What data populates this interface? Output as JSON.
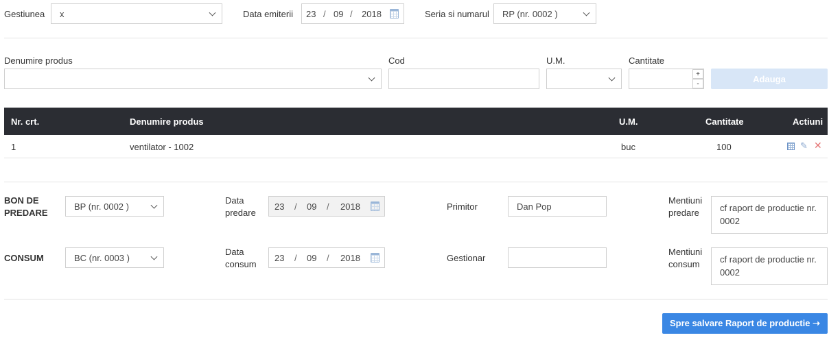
{
  "header": {
    "gestiunea_label": "Gestiunea",
    "gestiunea_value": "x",
    "data_emiterii_label": "Data emiterii",
    "data_emiterii": {
      "day": "23",
      "month": "09",
      "year": "2018"
    },
    "seria_label": "Seria si numarul",
    "seria_value": "RP (nr. 0002 )"
  },
  "form": {
    "denumire_label": "Denumire produs",
    "denumire_value": "",
    "cod_label": "Cod",
    "cod_value": "",
    "um_label": "U.M.",
    "um_value": "",
    "cantitate_label": "Cantitate",
    "cantitate_value": "",
    "plus": "+",
    "minus": "-",
    "add_label": "Adauga"
  },
  "table": {
    "headers": [
      "Nr. crt.",
      "Denumire produs",
      "U.M.",
      "Cantitate",
      "Actiuni"
    ],
    "rows": [
      {
        "nr": "1",
        "denumire": "ventilator - 1002",
        "um": "buc",
        "cantitate": "100"
      }
    ]
  },
  "bon": {
    "label_line1": "BON DE",
    "label_line2": "PREDARE",
    "value": "BP (nr. 0002 )",
    "data_label_line1": "Data",
    "data_label_line2": "predare",
    "date": {
      "day": "23",
      "month": "09",
      "year": "2018"
    },
    "primitor_label": "Primitor",
    "primitor_value": "Dan Pop",
    "mentiuni_label_line1": "Mentiuni",
    "mentiuni_label_line2": "predare",
    "mentiuni_line1": "cf raport de productie nr.",
    "mentiuni_line2": "0002"
  },
  "consum": {
    "label": "CONSUM",
    "value": "BC (nr. 0003 )",
    "data_label_line1": "Data",
    "data_label_line2": "consum",
    "date": {
      "day": "23",
      "month": "09",
      "year": "2018"
    },
    "gestionar_label": "Gestionar",
    "gestionar_value": "",
    "mentiuni_label_line1": "Mentiuni",
    "mentiuni_label_line2": "consum",
    "mentiuni_line1": "cf raport de productie nr.",
    "mentiuni_line2": "0002"
  },
  "footer": {
    "save_label": "Spre salvare Raport de productie ➝"
  },
  "date_sep": "/",
  "colors": {
    "primary": "#3a87e4",
    "add_disabled": "#d8e6f7",
    "table_header": "#2b2d33"
  }
}
